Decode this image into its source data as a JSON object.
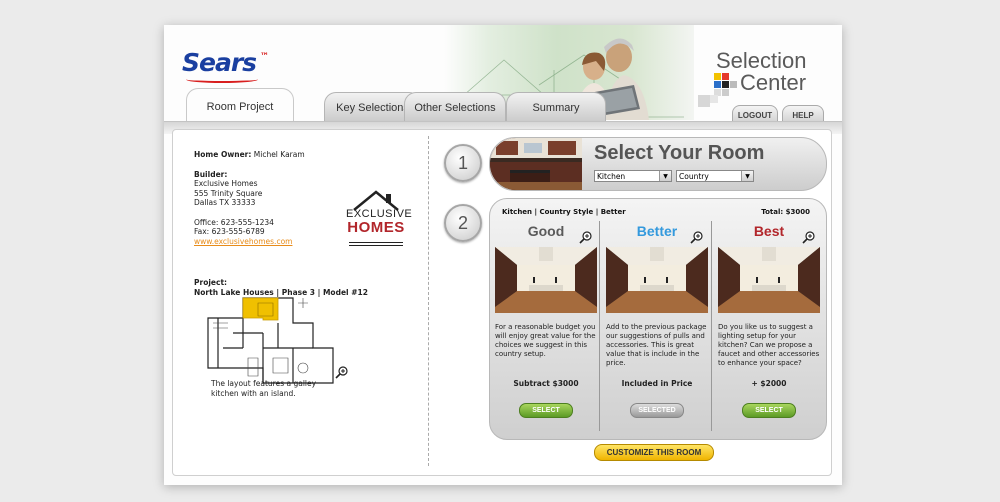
{
  "header": {
    "logo_text": "Sears",
    "app_title_line1": "Selection",
    "app_title_line2": "Center",
    "tabs": [
      {
        "label": "Room Project",
        "active": true
      },
      {
        "label": "Key Selections",
        "active": false
      },
      {
        "label": "Other Selections",
        "active": false
      },
      {
        "label": "Summary",
        "active": false
      }
    ],
    "logout_label": "LOGOUT",
    "help_label": "HELP"
  },
  "project_info": {
    "home_owner_label": "Home Owner:",
    "home_owner_name": "Michel Karam",
    "builder_label": "Builder:",
    "builder_name": "Exclusive Homes",
    "builder_address1": "555 Trinity Square",
    "builder_address2": "Dallas TX 33333",
    "office": "Office: 623-555-1234",
    "fax": "Fax: 623-555-6789",
    "website": "www.exclusivehomes.com",
    "builder_logo_word1": "EXCLUSIVE",
    "builder_logo_word2": "HOMES",
    "project_label": "Project:",
    "project_name": "North Lake Houses | Phase 3 | Model #12",
    "plan_caption": "The layout features a galley kitchen with an island."
  },
  "step1": {
    "number": "1",
    "title": "Select Your Room",
    "room_select_value": "Kitchen",
    "style_select_value": "Country"
  },
  "step2": {
    "number": "2",
    "summary": "Kitchen | Country Style | Better",
    "total": "Total: $3000",
    "options": [
      {
        "title": "Good",
        "title_color": "#5a5a5a",
        "description": "For a reasonable budget you will enjoy great value for the choices we suggest in this country setup.",
        "price": "Subtract $3000",
        "button_label": "SELECT",
        "selected": false
      },
      {
        "title": "Better",
        "title_color": "#3399dd",
        "description": "Add to the previous package our suggestions of pulls and accessories. This is great value that is include in the price.",
        "price": "Included in Price",
        "button_label": "SELECTED",
        "selected": true
      },
      {
        "title": "Best",
        "title_color": "#b2262b",
        "description": "Do you like us to suggest a lighting setup for your kitchen? Can we propose a faucet and other accessories to enhance your space?",
        "price": "+ $2000",
        "button_label": "SELECT",
        "selected": false
      }
    ],
    "customize_label": "CUSTOMIZE THIS ROOM"
  },
  "colors": {
    "sears_blue": "#1a3fa0",
    "select_green": "#5c9b26",
    "customize_yellow": "#f0b400",
    "link_orange": "#e88c1a"
  }
}
